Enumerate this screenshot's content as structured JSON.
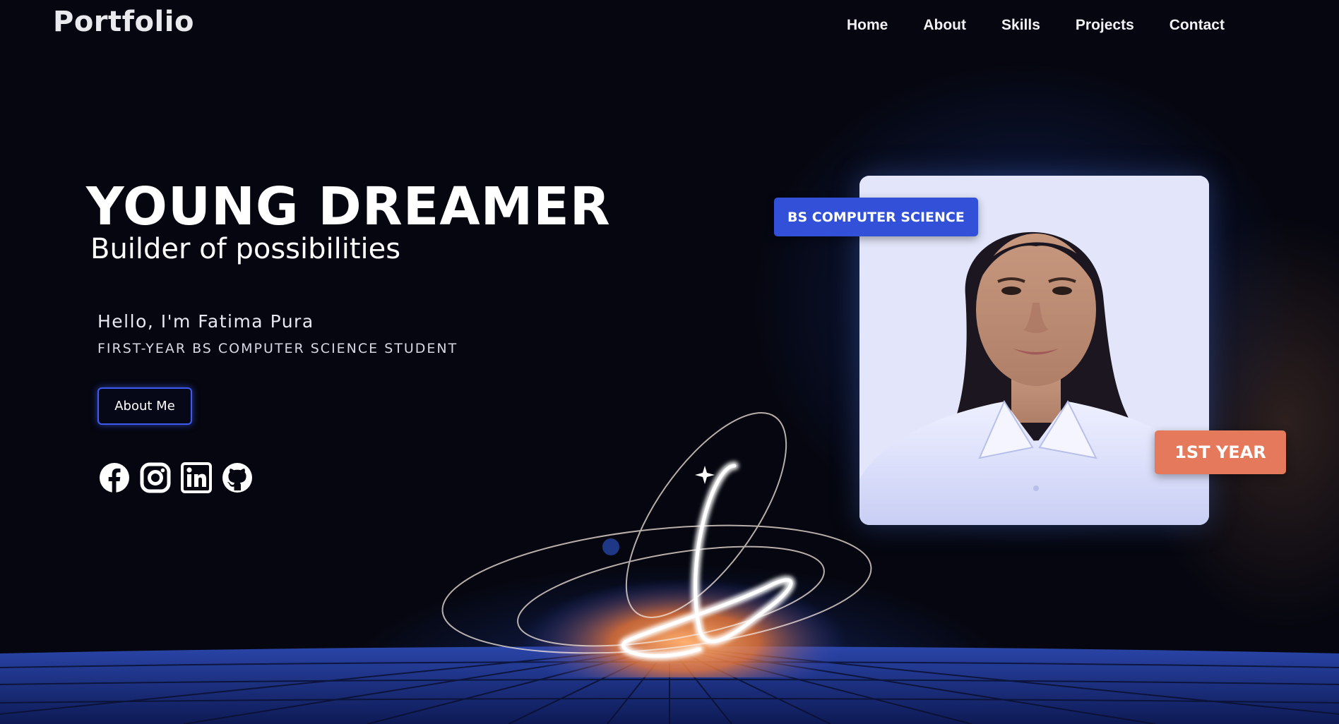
{
  "header": {
    "logo": "Portfolio",
    "nav": [
      {
        "label": "Home"
      },
      {
        "label": "About"
      },
      {
        "label": "Skills"
      },
      {
        "label": "Projects"
      },
      {
        "label": "Contact"
      }
    ]
  },
  "hero": {
    "title": "YOUNG DREAMER",
    "subtitle": "Builder of possibilities",
    "greeting": "Hello, I'm Fatima Pura",
    "role": "FIRST-YEAR BS COMPUTER SCIENCE STUDENT",
    "about_button": "About Me",
    "socials": [
      {
        "icon": "facebook-icon"
      },
      {
        "icon": "instagram-icon"
      },
      {
        "icon": "linkedin-icon"
      },
      {
        "icon": "github-icon"
      }
    ]
  },
  "profile": {
    "badge_program": "BS COMPUTER SCIENCE",
    "badge_year": "1ST YEAR"
  },
  "colors": {
    "background": "#05060f",
    "accent_blue": "#3351d8",
    "accent_orange": "#e47a5b",
    "button_border": "#3d5bf0"
  }
}
